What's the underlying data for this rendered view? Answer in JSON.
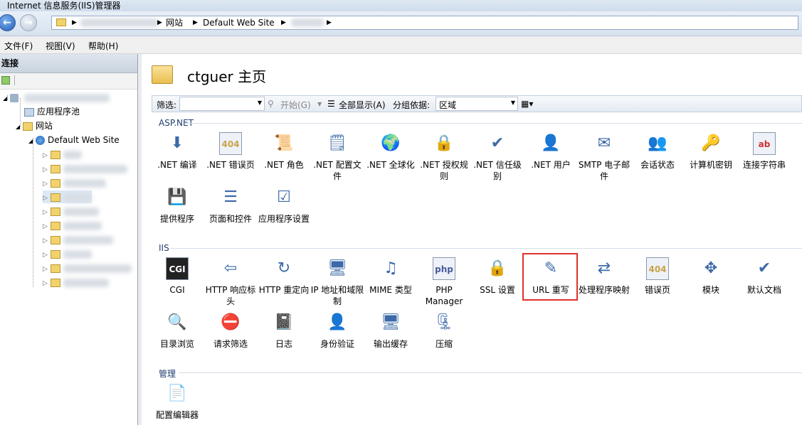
{
  "window": {
    "title": "Internet 信息服务(IIS)管理器"
  },
  "address": {
    "segments": [
      "网站",
      "Default Web Site"
    ]
  },
  "menu": [
    "文件(F)",
    "视图(V)",
    "帮助(H)"
  ],
  "connections": {
    "header": "连接",
    "tree": {
      "app_pools": "应用程序池",
      "sites": "网站",
      "default_site": "Default Web Site"
    }
  },
  "main": {
    "title": "ctguer 主页",
    "filter": {
      "label": "筛选:",
      "go": "开始(G)",
      "show_all": "全部显示(A)",
      "group_by": "分组依据:",
      "group_value": "区域"
    },
    "groups": {
      "aspnet": "ASP.NET",
      "iis": "IIS",
      "manage": "管理"
    },
    "aspnet_items": [
      {
        "label": ".NET 编译",
        "icon": "compile-icon"
      },
      {
        "label": ".NET 错误页",
        "icon": "error-page-icon"
      },
      {
        "label": ".NET 角色",
        "icon": "roles-icon"
      },
      {
        "label": ".NET 配置文件",
        "icon": "profile-icon"
      },
      {
        "label": ".NET 全球化",
        "icon": "globe-icon"
      },
      {
        "label": ".NET 授权规则",
        "icon": "authorization-icon"
      },
      {
        "label": ".NET 信任级别",
        "icon": "trust-icon"
      },
      {
        "label": ".NET 用户",
        "icon": "users-icon"
      },
      {
        "label": "SMTP 电子邮件",
        "icon": "email-icon"
      },
      {
        "label": "会话状态",
        "icon": "session-icon"
      },
      {
        "label": "计算机密钥",
        "icon": "machine-key-icon"
      },
      {
        "label": "连接字符串",
        "icon": "connection-string-icon"
      },
      {
        "label": "提供程序",
        "icon": "providers-icon"
      },
      {
        "label": "页面和控件",
        "icon": "pages-controls-icon"
      },
      {
        "label": "应用程序设置",
        "icon": "app-settings-icon"
      }
    ],
    "iis_items": [
      {
        "label": "CGI",
        "icon": "cgi-icon"
      },
      {
        "label": "HTTP 响应标头",
        "icon": "http-headers-icon"
      },
      {
        "label": "HTTP 重定向",
        "icon": "redirect-icon"
      },
      {
        "label": "IP 地址和域限制",
        "icon": "ip-restrict-icon"
      },
      {
        "label": "MIME 类型",
        "icon": "mime-icon"
      },
      {
        "label": "PHP Manager",
        "icon": "php-icon"
      },
      {
        "label": "SSL 设置",
        "icon": "lock-icon"
      },
      {
        "label": "URL 重写",
        "icon": "url-rewrite-icon"
      },
      {
        "label": "处理程序映射",
        "icon": "handler-icon"
      },
      {
        "label": "错误页",
        "icon": "error-page-icon"
      },
      {
        "label": "模块",
        "icon": "modules-icon"
      },
      {
        "label": "默认文档",
        "icon": "default-doc-icon"
      },
      {
        "label": "目录浏览",
        "icon": "dir-browse-icon"
      },
      {
        "label": "请求筛选",
        "icon": "request-filter-icon"
      },
      {
        "label": "日志",
        "icon": "logging-icon"
      },
      {
        "label": "身份验证",
        "icon": "auth-icon"
      },
      {
        "label": "输出缓存",
        "icon": "output-cache-icon"
      },
      {
        "label": "压缩",
        "icon": "compression-icon"
      }
    ],
    "manage_items": [
      {
        "label": "配置编辑器",
        "icon": "config-editor-icon"
      }
    ]
  }
}
